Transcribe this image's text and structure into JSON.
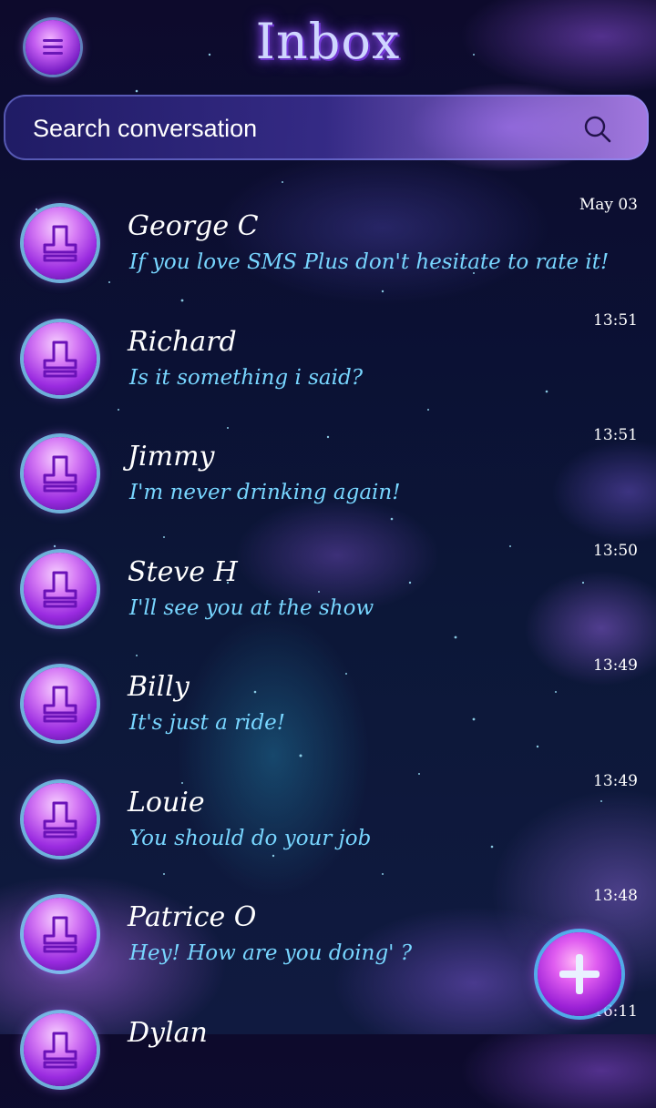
{
  "header": {
    "title": "Inbox",
    "menu_icon": "hamburger-menu-icon"
  },
  "search": {
    "placeholder": "Search conversation",
    "icon": "search-icon"
  },
  "conversations": [
    {
      "name": "George C",
      "message": "If you love SMS Plus don't hesitate to rate it!",
      "time": "May 03"
    },
    {
      "name": "Richard",
      "message": "Is it something i said?",
      "time": "13:51"
    },
    {
      "name": "Jimmy",
      "message": "I'm never drinking again!",
      "time": "13:51"
    },
    {
      "name": "Steve H",
      "message": "I'll see you at the show",
      "time": "13:50"
    },
    {
      "name": "Billy",
      "message": "It's just a ride!",
      "time": "13:49"
    },
    {
      "name": "Louie",
      "message": "You should do your job",
      "time": "13:49"
    },
    {
      "name": "Patrice O",
      "message": "Hey! How are you doing' ?",
      "time": "13:48"
    },
    {
      "name": "Dylan",
      "message": "",
      "time": "16:11"
    }
  ],
  "fab": {
    "icon": "plus-icon"
  },
  "colors": {
    "accent": "#b04ae8",
    "message_text": "#78d6ff",
    "name_text": "#ffffff"
  }
}
